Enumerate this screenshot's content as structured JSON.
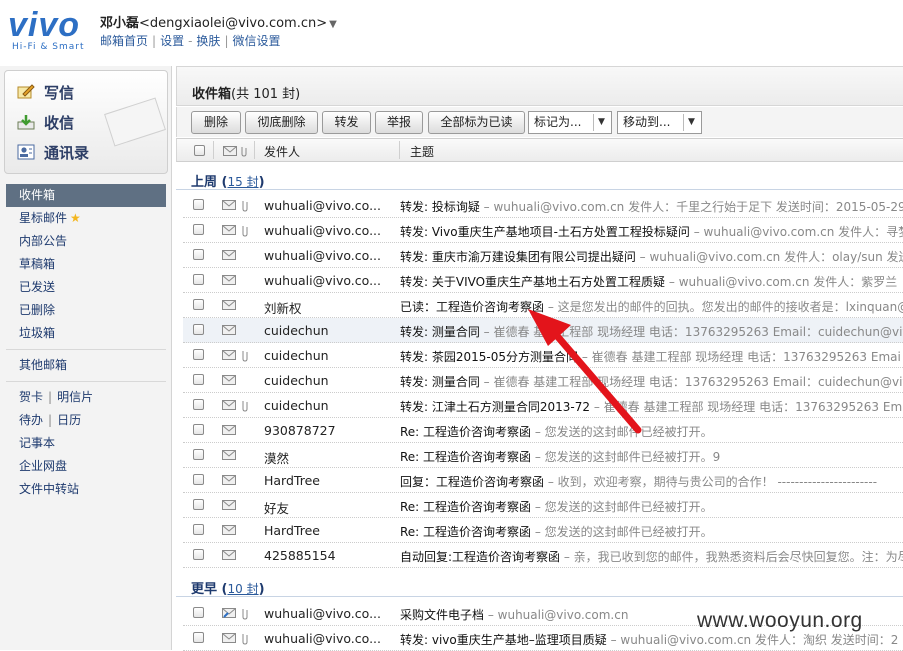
{
  "header": {
    "logo_text": "vivo",
    "logo_tagline": "Hi-Fi & Smart",
    "user_name": "邓小磊",
    "user_email": "<dengxiaolei@vivo.com.cn>",
    "links": [
      "邮箱首页",
      "设置",
      "换肤",
      "微信设置"
    ]
  },
  "sidebar": {
    "big_buttons": [
      "写信",
      "收信",
      "通讯录"
    ],
    "items": [
      "收件箱",
      "星标邮件",
      "内部公告",
      "草稿箱",
      "已发送",
      "已删除",
      "垃圾箱"
    ],
    "other": "其他邮箱",
    "pair1": [
      "贺卡",
      "明信片"
    ],
    "pair2": [
      "待办",
      "日历"
    ],
    "tools": [
      "记事本",
      "企业网盘",
      "文件中转站"
    ]
  },
  "main": {
    "title": "收件箱",
    "count": "(共 101 封)",
    "toolbar": {
      "delete": "删除",
      "perm_delete": "彻底删除",
      "forward": "转发",
      "report": "举报",
      "mark_all_read": "全部标为已读",
      "mark_as": "标记为...",
      "move_to": "移动到..."
    },
    "columns": {
      "sender": "发件人",
      "subject": "主题"
    },
    "groups": [
      {
        "label": "上周",
        "count": "15 封"
      },
      {
        "label": "更早",
        "count": "10 封"
      }
    ],
    "rows": [
      {
        "from": "wuhuali@vivo.co...",
        "subject": "转发: 投标询疑",
        "snippet": " – wuhuali@vivo.com.cn 发件人：千里之行始于足下 发送时间：2015-05-29"
      },
      {
        "from": "wuhuali@vivo.co...",
        "subject": "转发: Vivo重庆生产基地项目-土石方处置工程投标疑问",
        "snippet": " – wuhuali@vivo.com.cn 发件人：寻梦"
      },
      {
        "from": "wuhuali@vivo.co...",
        "subject": "转发: 重庆市渝万建设集团有限公司提出疑问",
        "snippet": " – wuhuali@vivo.com.cn 发件人：olay/sun 发送"
      },
      {
        "from": "wuhuali@vivo.co...",
        "subject": "转发: 关于VIVO重庆生产基地土石方处置工程质疑",
        "snippet": " – wuhuali@vivo.com.cn 发件人：紫罗兰"
      },
      {
        "from": "刘新权",
        "subject": "已读：工程造价咨询考察函",
        "snippet": " – 这是您发出的邮件的回执。您发出的邮件的接收者是：lxinquan@"
      },
      {
        "from": "cuidechun",
        "subject": "转发: 测量合同",
        "snippet": " – 崔德春 基建工程部 现场经理 电话：13763295263 Email：cuidechun@viv"
      },
      {
        "from": "cuidechun",
        "subject": "转发: 茶园2015-05分方测量合同",
        "snippet": " – 崔德春 基建工程部 现场经理 电话：13763295263 Emai"
      },
      {
        "from": "cuidechun",
        "subject": "转发: 测量合同",
        "snippet": " – 崔德春 基建工程部 现场经理 电话：13763295263 Email：cuidechun@viv"
      },
      {
        "from": "cuidechun",
        "subject": "转发: 江津土石方测量合同2013-72",
        "snippet": " – 崔德春 基建工程部 现场经理 电话：13763295263 Em"
      },
      {
        "from": "930878727",
        "subject": "Re: 工程造价咨询考察函",
        "snippet": " – 您发送的这封邮件已经被打开。"
      },
      {
        "from": "漠然",
        "subject": "Re: 工程造价咨询考察函",
        "snippet": " – 您发送的这封邮件已经被打开。9"
      },
      {
        "from": "HardTree",
        "subject": "回复：工程造价咨询考察函",
        "snippet": " – 收到，欢迎考察，期待与贵公司的合作！ -----------------------"
      },
      {
        "from": "好友",
        "subject": "Re: 工程造价咨询考察函",
        "snippet": " – 您发送的这封邮件已经被打开。"
      },
      {
        "from": "HardTree",
        "subject": "Re: 工程造价咨询考察函",
        "snippet": " – 您发送的这封邮件已经被打开。"
      },
      {
        "from": "425885154",
        "subject": "自动回复:工程造价咨询考察函",
        "snippet": " – 亲，我已收到您的邮件，我熟悉资料后会尽快回复您。注：为尽"
      },
      {
        "from": "wuhuali@vivo.co...",
        "subject": "采购文件电子档",
        "snippet": " – wuhuali@vivo.com.cn"
      },
      {
        "from": "wuhuali@vivo.co...",
        "subject": "转发: vivo重庆生产基地–监理项目质疑",
        "snippet": " – wuhuali@vivo.com.cn 发件人：淘织 发送时间：2"
      }
    ]
  },
  "watermark": "www.wooyun.org",
  "colors": {
    "accent": "#2d6fc4",
    "arrow": "#e3141b",
    "selected_nav": "#5f7083"
  }
}
